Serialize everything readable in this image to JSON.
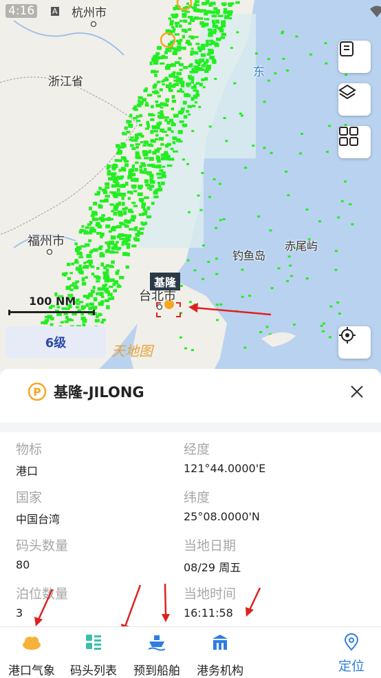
{
  "status_bar": {
    "time": "4:16",
    "indicator": "A"
  },
  "map": {
    "labels": {
      "hangzhou": "杭州市",
      "zhejiang": "浙江省",
      "fuzhou": "福州市",
      "taibei": "台北市",
      "diaoyu": "钓鱼岛",
      "chiwei": "赤尾屿",
      "dong": "东"
    },
    "port_tag": "基隆",
    "scale_label": "100 NM",
    "zoom_level": "6级",
    "watermark": "天地图",
    "side_buttons": [
      "list-icon",
      "layers-icon",
      "grid-icon",
      "locate-target-icon"
    ],
    "colors": {
      "ships": "#22ee22",
      "sea": "#b9d2ef",
      "land": "#f1efe9",
      "annotation": "#e02020"
    }
  },
  "panel": {
    "title": "基隆-JILONG",
    "fields": [
      {
        "key": "物标",
        "value": "港口"
      },
      {
        "key": "经度",
        "value": "121°44.0000'E"
      },
      {
        "key": "国家",
        "value": "中国台湾"
      },
      {
        "key": "纬度",
        "value": "25°08.0000'N"
      },
      {
        "key": "码头数量",
        "value": "80"
      },
      {
        "key": "当地日期",
        "value": "08/29 周五"
      },
      {
        "key": "泊位数量",
        "value": "3"
      },
      {
        "key": "当地时间",
        "value": "16:11:58"
      }
    ]
  },
  "tabs": [
    {
      "label": "港口气象",
      "icon": "weather-icon"
    },
    {
      "label": "码头列表",
      "icon": "dock-list-icon"
    },
    {
      "label": "预到船舶",
      "icon": "ship-icon"
    },
    {
      "label": "港务机构",
      "icon": "port-authority-icon"
    },
    {
      "label": "定位",
      "icon": "location-pin-icon"
    }
  ]
}
